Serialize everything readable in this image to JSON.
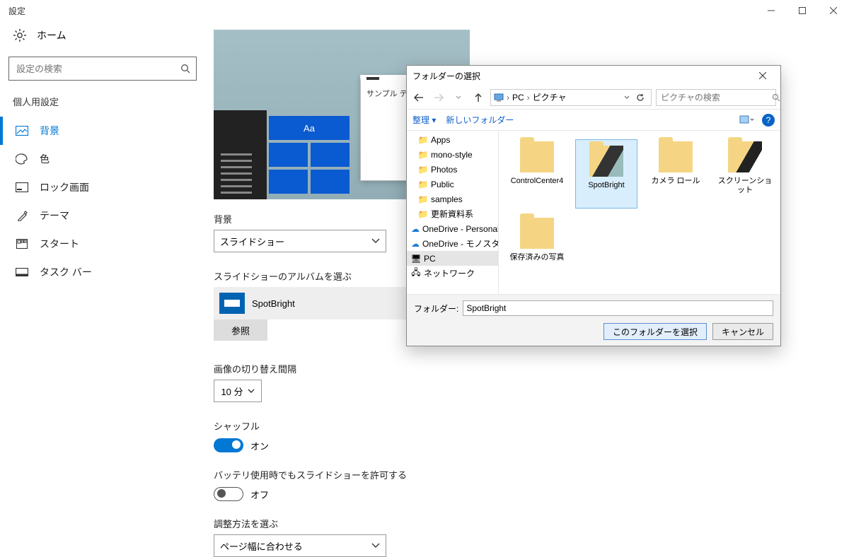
{
  "window": {
    "title": "設定"
  },
  "sidebar": {
    "home": "ホーム",
    "search_placeholder": "設定の検索",
    "category": "個人用設定",
    "items": [
      {
        "label": "背景",
        "icon": "picture-icon",
        "active": true
      },
      {
        "label": "色",
        "icon": "palette-icon"
      },
      {
        "label": "ロック画面",
        "icon": "lock-screen-icon"
      },
      {
        "label": "テーマ",
        "icon": "theme-icon"
      },
      {
        "label": "スタート",
        "icon": "start-icon"
      },
      {
        "label": "タスク バー",
        "icon": "taskbar-icon"
      }
    ]
  },
  "content": {
    "preview_sample": "サンプル テキス",
    "preview_aa": "Aa",
    "background_label": "背景",
    "background_value": "スライドショー",
    "album_label": "スライドショーのアルバムを選ぶ",
    "album_value": "SpotBright",
    "browse": "参照",
    "interval_label": "画像の切り替え間隔",
    "interval_value": "10 分",
    "shuffle_label": "シャッフル",
    "shuffle_state": "オン",
    "battery_label": "バッテリ使用時でもスライドショーを許可する",
    "battery_state": "オフ",
    "fit_label": "調整方法を選ぶ",
    "fit_value": "ページ幅に合わせる"
  },
  "dialog": {
    "title": "フォルダーの選択",
    "breadcrumb": [
      "PC",
      "ピクチャ"
    ],
    "search_placeholder": "ピクチャの検索",
    "tool_organize": "整理",
    "tool_newfolder": "新しいフォルダー",
    "tree": [
      {
        "label": "Apps",
        "icon": "folder"
      },
      {
        "label": "mono-style",
        "icon": "folder"
      },
      {
        "label": "Photos",
        "icon": "folder"
      },
      {
        "label": "Public",
        "icon": "folder"
      },
      {
        "label": "samples",
        "icon": "folder"
      },
      {
        "label": "更新資料系",
        "icon": "folder"
      },
      {
        "label": "OneDrive - Personal",
        "icon": "onedrive"
      },
      {
        "label": "OneDrive - モノスタ",
        "icon": "onedrive"
      },
      {
        "label": "PC",
        "icon": "pc",
        "selected": true
      },
      {
        "label": "ネットワーク",
        "icon": "network"
      }
    ],
    "folders": [
      {
        "label": "ControlCenter4"
      },
      {
        "label": "SpotBright",
        "selected": true
      },
      {
        "label": "カメラ ロール"
      },
      {
        "label": "スクリーンショット"
      },
      {
        "label": "保存済みの写真"
      }
    ],
    "folder_field_label": "フォルダー:",
    "folder_field_value": "SpotBright",
    "select_button": "このフォルダーを選択",
    "cancel_button": "キャンセル"
  }
}
